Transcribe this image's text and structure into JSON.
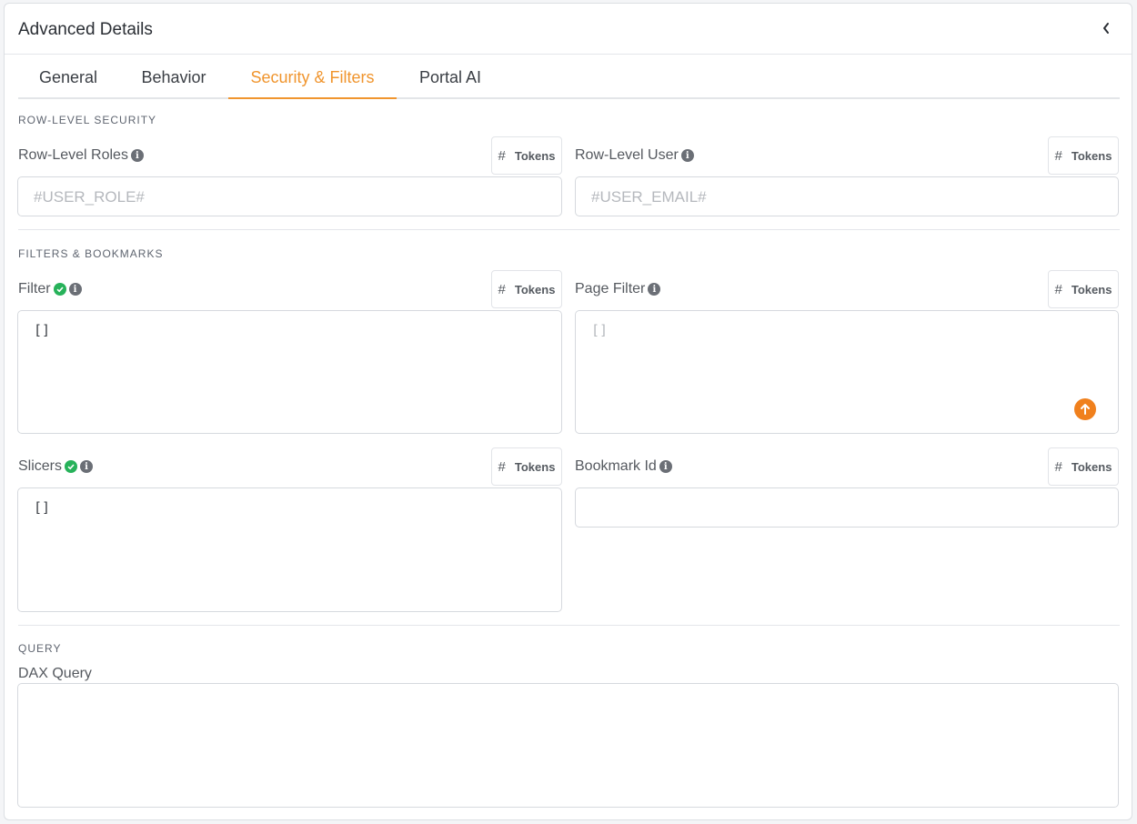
{
  "panel": {
    "title": "Advanced Details"
  },
  "tabs": [
    {
      "label": "General"
    },
    {
      "label": "Behavior"
    },
    {
      "label": "Security & Filters",
      "active": true
    },
    {
      "label": "Portal AI"
    }
  ],
  "sections": {
    "row_level_security": "ROW-LEVEL SECURITY",
    "filters_bookmarks": "FILTERS & BOOKMARKS",
    "query": "QUERY"
  },
  "tokens_label": "Tokens",
  "fields": {
    "row_level_roles": {
      "label": "Row-Level Roles",
      "placeholder": "#USER_ROLE#",
      "value": ""
    },
    "row_level_user": {
      "label": "Row-Level User",
      "placeholder": "#USER_EMAIL#",
      "value": ""
    },
    "filter": {
      "label": "Filter",
      "value": "[]",
      "valid": true
    },
    "page_filter": {
      "label": "Page Filter",
      "placeholder": "[]",
      "value": ""
    },
    "slicers": {
      "label": "Slicers",
      "value": "[]",
      "valid": true
    },
    "bookmark_id": {
      "label": "Bookmark Id",
      "value": ""
    },
    "dax_query": {
      "label": "DAX Query",
      "value": ""
    }
  },
  "colors": {
    "accent": "#f0952e",
    "success": "#27b25a",
    "upload": "#f0801d"
  }
}
